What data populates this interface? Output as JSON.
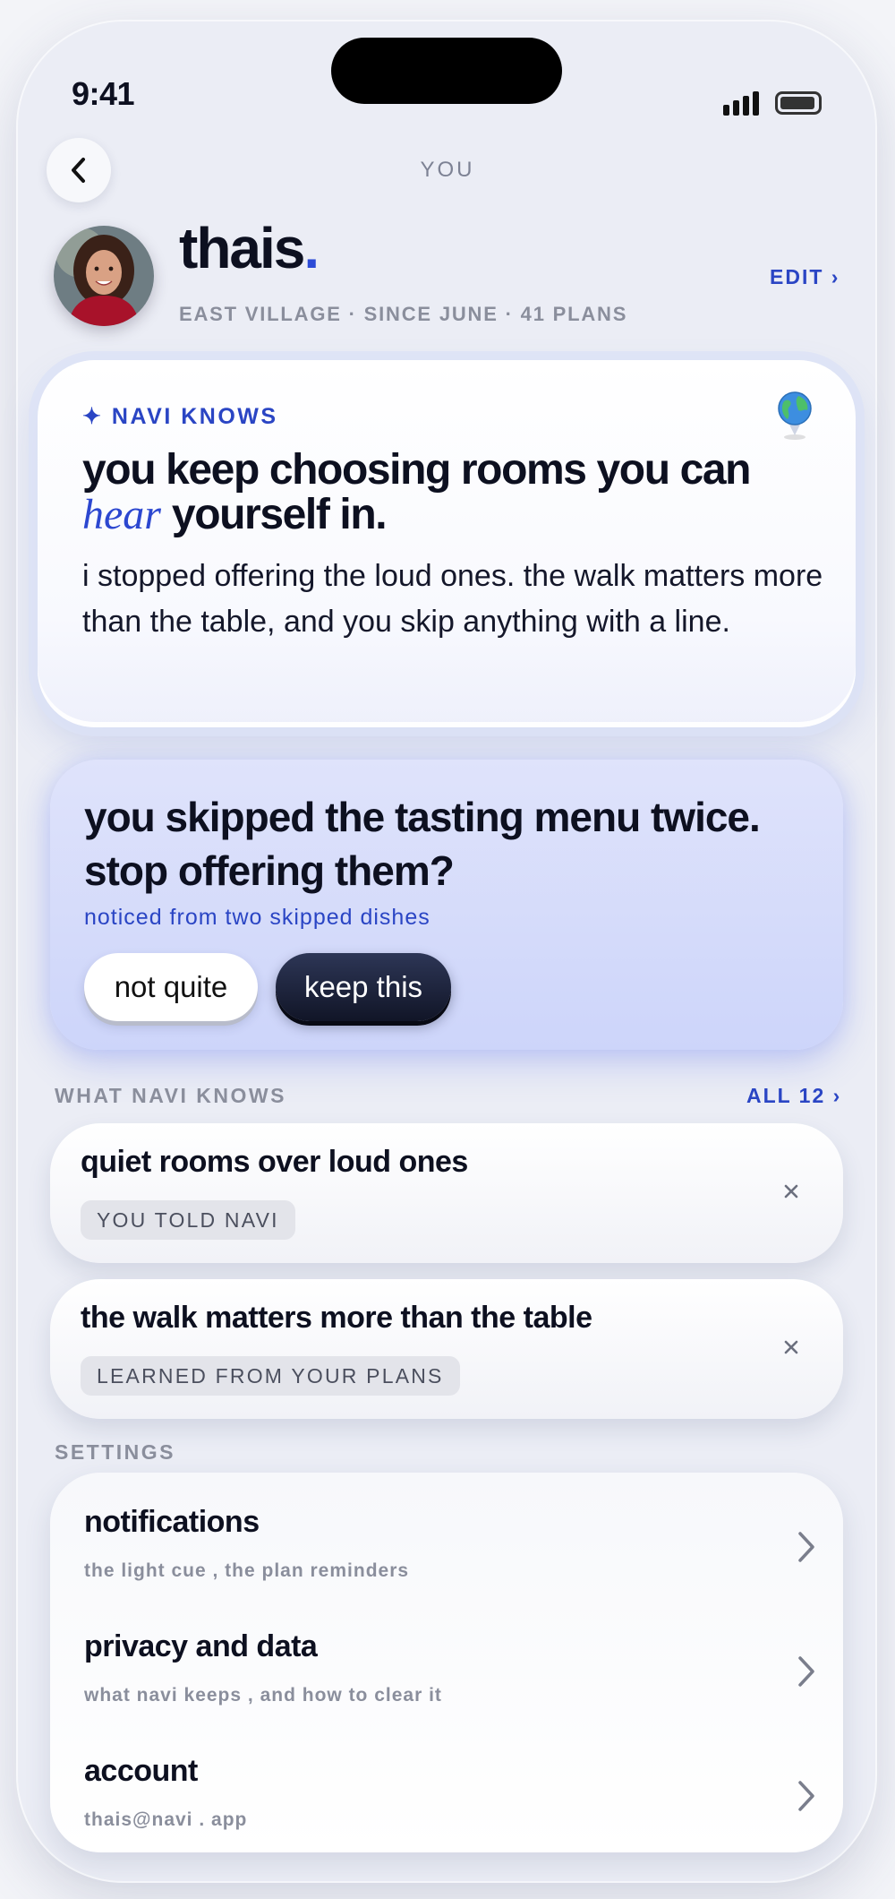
{
  "status": {
    "time": "9:41"
  },
  "nav": {
    "title": "YOU"
  },
  "profile": {
    "name": "thais",
    "name_dot": ".",
    "meta": "EAST VILLAGE · SINCE JUNE · 41 PLANS",
    "edit_label": "EDIT ›"
  },
  "insight": {
    "tag": "✦ NAVI KNOWS",
    "headline_part1": "you keep choosing rooms you can",
    "headline_emphasis": "hear",
    "headline_part2": "yourself in.",
    "body": "i stopped offering the loud ones. the walk matters more than the table, and you skip anything with a line."
  },
  "question": {
    "text": "you skipped the tasting menu twice. stop offering them?",
    "note": "noticed from two skipped dishes",
    "decline_label": "not quite",
    "accept_label": "keep this"
  },
  "knows": {
    "section_label": "WHAT NAVI KNOWS",
    "all_label": "ALL 12 ›",
    "facts": [
      {
        "title": "quiet rooms over loud ones",
        "source": "YOU TOLD NAVI"
      },
      {
        "title": "the walk matters more than the table",
        "source": "LEARNED FROM YOUR PLANS"
      }
    ]
  },
  "settings": {
    "section_label": "SETTINGS",
    "items": [
      {
        "title": "notifications",
        "subtitle": "the light cue , the plan reminders"
      },
      {
        "title": "privacy and data",
        "subtitle": "what navi keeps , and how to clear it"
      },
      {
        "title": "account",
        "subtitle": "thais@navi . app"
      }
    ]
  },
  "colors": {
    "accent": "#2a45c4",
    "background": "#ebedf5",
    "question_card": "#d6dcfa",
    "dark_button": "#151a2e"
  },
  "icons": [
    "back-chevron-icon",
    "signal-icon",
    "battery-icon",
    "sparkle-icon",
    "globe-pin-icon",
    "close-icon",
    "chevron-right-icon"
  ]
}
